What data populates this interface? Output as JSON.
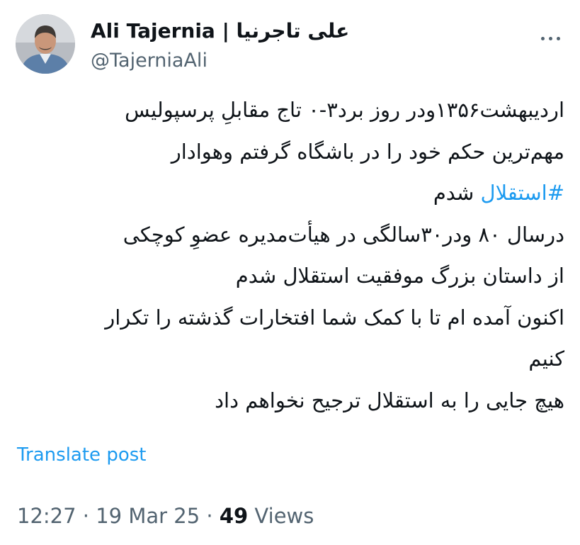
{
  "author": {
    "display_name": "Ali Tajernia | علی تاجرنیا",
    "handle": "@TajerniaAli",
    "avatar_icon": "profile-photo"
  },
  "more_icon": "more-horizontal-icon",
  "tweet": {
    "lines": [
      {
        "text": "اردیبهشت۱۳۵۶ودر روز برد۳-۰ تاج مقابلِ پرسپولیس"
      },
      {
        "text": "مهم‌ترین حکم خود را در باشگاه گرفتم وهوادار"
      },
      {
        "hashtag": "#استقلال",
        "text": " شدم"
      },
      {
        "text": "درسال ۸۰ ودر۳۰سالگی در هیأت‌مدیره عضوِ کوچکی"
      },
      {
        "text": "از داستان بزرگ موفقیت استقلال شدم"
      },
      {
        "text": "اکنون آمده ام تا با کمک شما افتخارات گذشته را تکرار"
      },
      {
        "text": "کنیم"
      },
      {
        "text": "هیچ جایی را به استقلال ترجیح نخواهم داد"
      }
    ]
  },
  "translate_label": "Translate post",
  "meta": {
    "time": "12:27",
    "separator1": " · ",
    "date": "19 Mar 25",
    "separator2": " · ",
    "views_count": "49",
    "views_label": " Views"
  },
  "colors": {
    "link": "#1d9bf0",
    "text": "#0f1419",
    "secondary": "#536471"
  }
}
